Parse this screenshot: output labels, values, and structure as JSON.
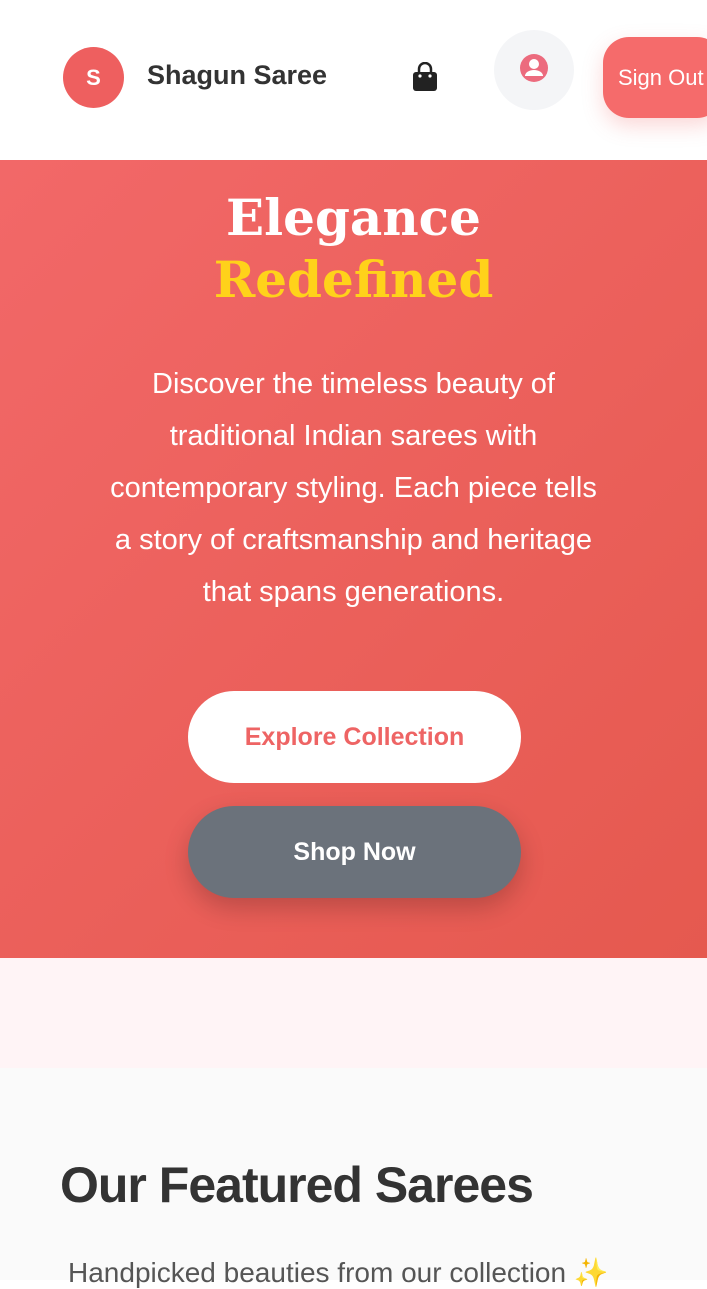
{
  "header": {
    "logo_letter": "S",
    "brand_name": "Shagun Saree",
    "bag_icon": "shopping-bag-icon",
    "profile_icon": "user-circle-icon",
    "sign_out_label": "Sign Out",
    "accent_color": "#ee5f5f"
  },
  "hero": {
    "title_line1": "Elegance",
    "title_line2": "Redefined",
    "description": "Discover the timeless beauty of traditional Indian sarees with contemporary styling. Each piece tells a story of craftsmanship and heritage that spans generations.",
    "explore_button": "Explore Collection",
    "shop_button": "Shop Now",
    "highlight_color": "#ffd21a"
  },
  "featured": {
    "title": "Our Featured Sarees",
    "subtitle": "Handpicked beauties from our collection ✨"
  }
}
